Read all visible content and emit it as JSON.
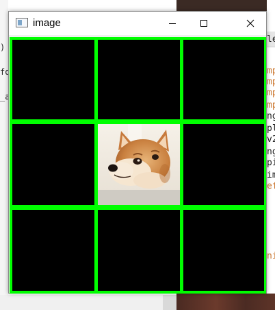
{
  "window": {
    "title": "image",
    "controls": {
      "minimize": "minimize-icon",
      "maximize": "maximize-icon",
      "close": "close-icon"
    }
  },
  "background": {
    "left_fragments": [
      ")",
      "fo",
      "_a"
    ],
    "right_fragments": [
      {
        "text": "le",
        "color": "#222222"
      },
      {
        "text": "mp",
        "color": "#cc7832"
      },
      {
        "text": "mp",
        "color": "#cc7832"
      },
      {
        "text": "mp",
        "color": "#cc7832"
      },
      {
        "text": "mp",
        "color": "#cc7832"
      },
      {
        "text": "ng",
        "color": "#222222"
      },
      {
        "text": "pl",
        "color": "#222222"
      },
      {
        "text": "v2",
        "color": "#222222"
      },
      {
        "text": "ng",
        "color": "#222222"
      },
      {
        "text": "pi",
        "color": "#222222"
      },
      {
        "text": "im",
        "color": "#222222"
      },
      {
        "text": "ef",
        "color": "#cc7832"
      },
      {
        "text": "ni",
        "color": "#cc7832"
      }
    ]
  },
  "grid": {
    "rows": 3,
    "cols": 3,
    "border_color": "#00ff00",
    "cell_color": "#000000",
    "image_cell": {
      "row": 1,
      "col": 1,
      "subject": "doge-face-image"
    }
  }
}
